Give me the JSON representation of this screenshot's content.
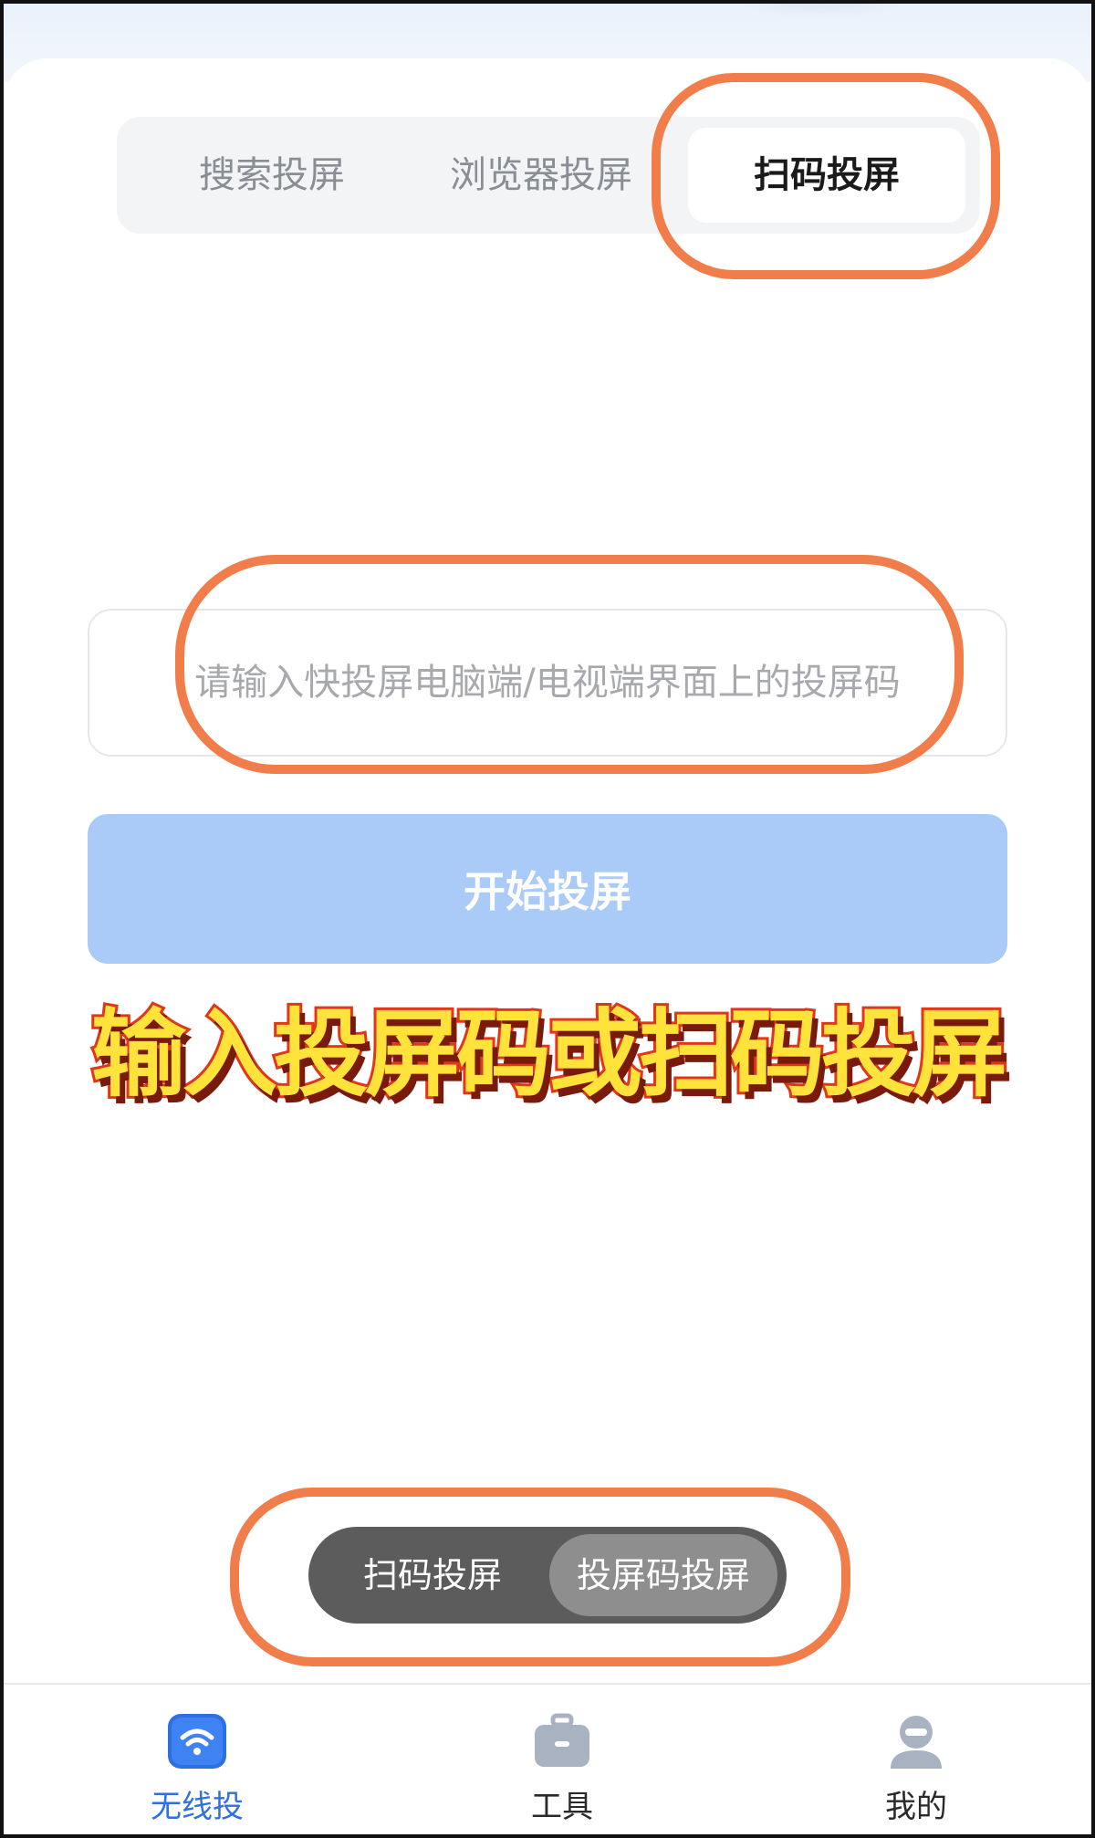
{
  "tabs": [
    {
      "label": "搜索投屏"
    },
    {
      "label": "浏览器投屏"
    },
    {
      "label": "扫码投屏"
    }
  ],
  "input": {
    "placeholder": "请输入快投屏电脑端/电视端界面上的投屏码",
    "value": ""
  },
  "start_button": {
    "label": "开始投屏"
  },
  "overlay_caption": "输入投屏码或扫码投屏",
  "mode_switch": {
    "left_label": "扫码投屏",
    "right_label": "投屏码投屏",
    "selected": "投屏码投屏"
  },
  "bottom_nav": [
    {
      "label": "无线投",
      "icon": "wifi-cast-icon",
      "active": true
    },
    {
      "label": "工具",
      "icon": "toolbox-icon",
      "active": false
    },
    {
      "label": "我的",
      "icon": "user-icon",
      "active": false
    }
  ],
  "colors": {
    "accent": "#2f6fe4",
    "button_disabled": "#aacbf7",
    "annotation": "#f07d4a",
    "caption_fill": "#ffe23a",
    "caption_stroke": "#e0361a"
  }
}
